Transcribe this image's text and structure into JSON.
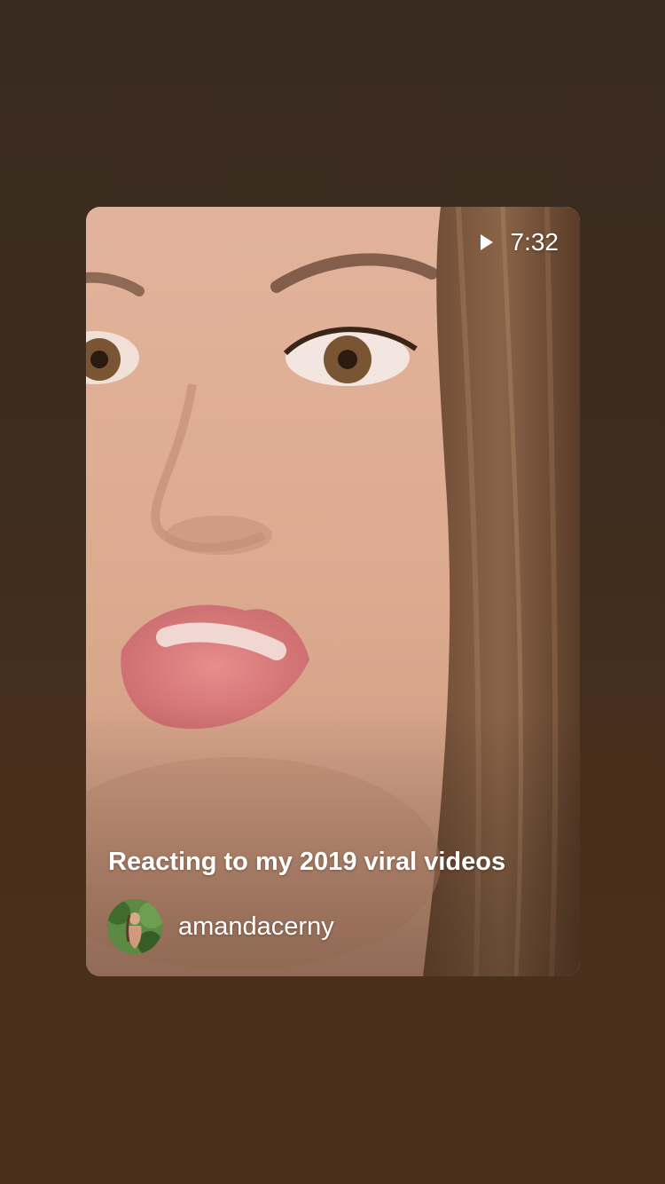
{
  "video_card": {
    "duration": "7:32",
    "title": "Reacting to my 2019 viral videos",
    "username": "amandacerny",
    "play_icon": "play-icon"
  },
  "colors": {
    "background_top": "#3a2b20",
    "background_bottom": "#4a301b",
    "text": "#ffffff"
  }
}
